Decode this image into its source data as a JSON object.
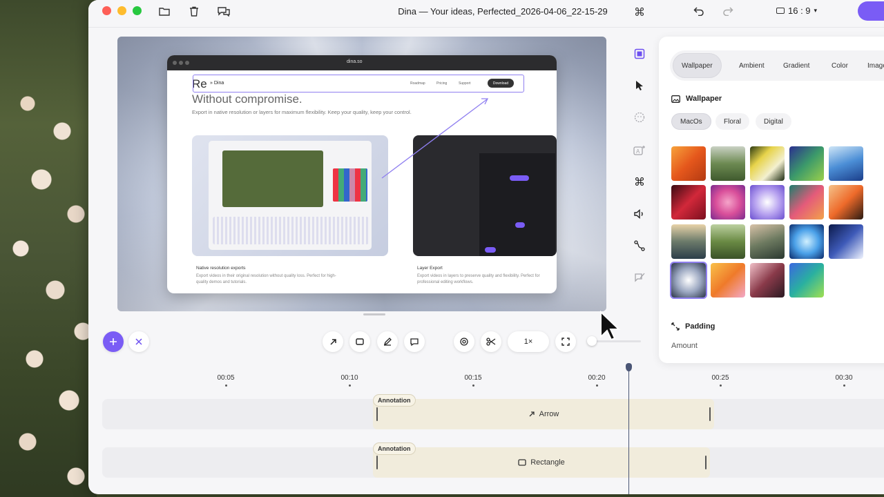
{
  "titlebar": {
    "title": "Dina — Your ideas, Perfected_2026-04-06_22-15-29",
    "aspect_ratio": "16 : 9",
    "icons": [
      "folder-icon",
      "trash-icon",
      "chat-icon",
      "command-icon",
      "undo-icon",
      "redo-icon"
    ]
  },
  "canvas": {
    "browser_url": "dina.so",
    "site": {
      "logo": "Dina",
      "nav": [
        "Roadmap",
        "Pricing",
        "Support"
      ],
      "download": "Download",
      "heading_partial": "Re",
      "heading_line2": "Without compromise.",
      "subheading": "Export in native resolution or layers for maximum flexibility. Keep your quality, keep your control.",
      "card1_title": "Native resolution exports",
      "card1_text": "Export videos in their original resolution without quality loss. Perfect for high-quality demos and tutorials.",
      "card2_title": "Layer Export",
      "card2_text": "Export videos in layers to preserve quality and flexibility. Perfect for professional editing workflows."
    }
  },
  "tools": [
    "frame-icon",
    "pointer-icon",
    "face-icon",
    "text-sparkle-icon",
    "command-icon",
    "speaker-icon",
    "path-icon",
    "annotate-icon"
  ],
  "panel": {
    "tabs": [
      "Wallpaper",
      "Ambient",
      "Gradient",
      "Color",
      "Image"
    ],
    "active_tab": "Wallpaper",
    "section_title": "Wallpaper",
    "chips": [
      "MacOs",
      "Floral",
      "Digital"
    ],
    "active_chip": "MacOs",
    "padding_title": "Padding",
    "amount_label": "Amount",
    "selected_wallpaper_index": 18
  },
  "toolbar": {
    "speed": "1×"
  },
  "timeline": {
    "ticks": [
      "00:05",
      "00:10",
      "00:15",
      "00:20",
      "00:25",
      "00:30"
    ],
    "tracks": [
      {
        "tag": "Annotation",
        "label": "Arrow",
        "icon": "arrow-up-right-icon"
      },
      {
        "tag": "Annotation",
        "label": "Rectangle",
        "icon": "rectangle-icon"
      }
    ]
  },
  "colors": {
    "accent": "#7a5cf5",
    "clip": "#f1ecdc"
  }
}
